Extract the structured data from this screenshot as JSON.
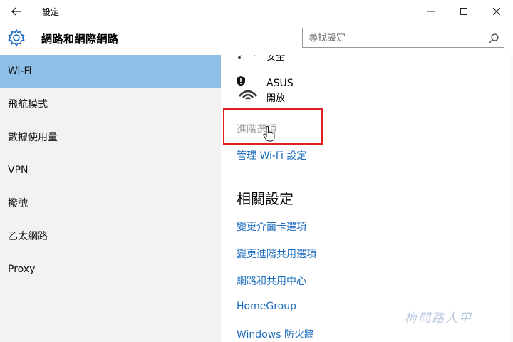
{
  "window": {
    "title": "設定"
  },
  "header": {
    "title": "網路和網際網路",
    "search_placeholder": "尋找設定"
  },
  "sidebar": {
    "items": [
      {
        "label": "Wi-Fi",
        "active": true
      },
      {
        "label": "飛航模式",
        "active": false
      },
      {
        "label": "數據使用量",
        "active": false
      },
      {
        "label": "VPN",
        "active": false
      },
      {
        "label": "撥號",
        "active": false
      },
      {
        "label": "乙太網路",
        "active": false
      },
      {
        "label": "Proxy",
        "active": false
      }
    ]
  },
  "content": {
    "partial_network_status": "安全",
    "network": {
      "name": "ASUS",
      "status": "開放"
    },
    "advanced_options": "進階選項",
    "manage_wifi": "管理 Wi-Fi 設定",
    "related_title": "相關設定",
    "related_links": [
      "變更介面卡選項",
      "變更進階共用選項",
      "網路和共用中心",
      "HomeGroup",
      "Windows 防火牆"
    ]
  },
  "watermark": "梅問路人甲",
  "colors": {
    "sidebar_bg": "#f2f2f2",
    "active_bg": "#8ebfe6",
    "link": "#1a6bbd",
    "highlight": "#e02020"
  }
}
